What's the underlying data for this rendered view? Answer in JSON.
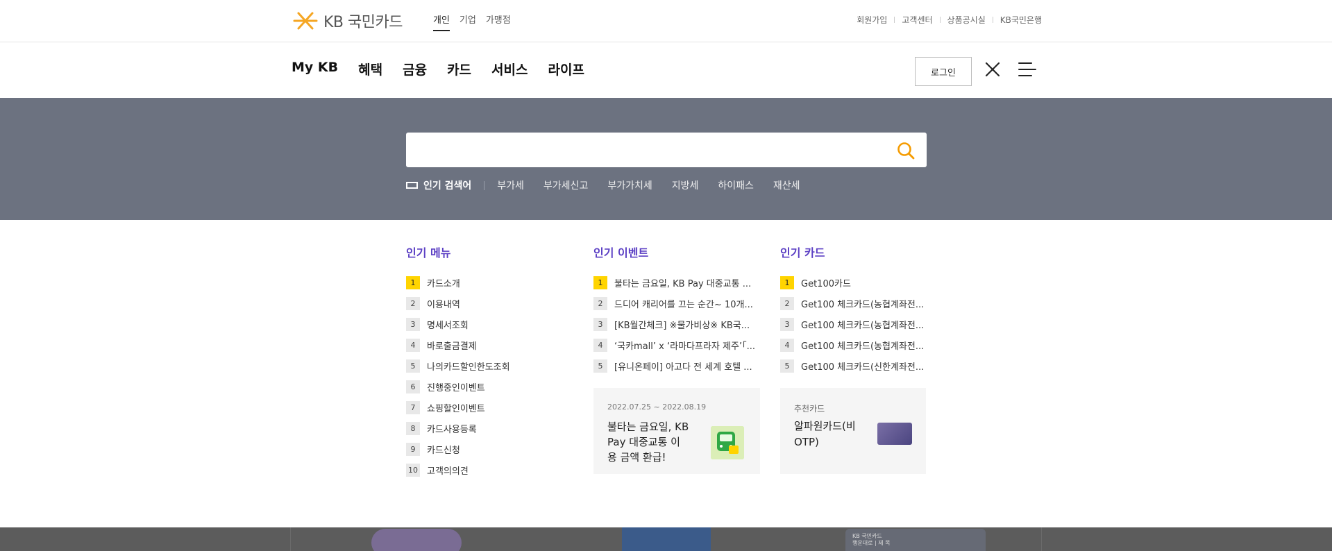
{
  "brand": {
    "logo_text": "KB 국민카드",
    "accent": "#f5a623"
  },
  "segment": [
    "개인",
    "기업",
    "가맹점"
  ],
  "utility_links": [
    "회원가입",
    "고객센터",
    "상품공시실",
    "KB국민은행"
  ],
  "gnb": {
    "items": [
      "My KB",
      "혜택",
      "금융",
      "카드",
      "서비스",
      "라이프"
    ],
    "login_label": "로그인"
  },
  "search": {
    "placeholder": "",
    "popular_title": "인기 검색어",
    "keywords": [
      "부가세",
      "부가세신고",
      "부가가치세",
      "지방세",
      "하이패스",
      "재산세"
    ]
  },
  "popular_menu": {
    "title": "인기 메뉴",
    "items": [
      {
        "rank": "1",
        "text": "카드소개"
      },
      {
        "rank": "2",
        "text": "이용내역"
      },
      {
        "rank": "3",
        "text": "명세서조회"
      },
      {
        "rank": "4",
        "text": "바로출금결제"
      },
      {
        "rank": "5",
        "text": "나의카드할인한도조회"
      },
      {
        "rank": "6",
        "text": "진행중인이벤트"
      },
      {
        "rank": "7",
        "text": "쇼핑할인이벤트"
      },
      {
        "rank": "8",
        "text": "카드사용등록"
      },
      {
        "rank": "9",
        "text": "카드신청"
      },
      {
        "rank": "10",
        "text": "고객의의견"
      }
    ]
  },
  "popular_events": {
    "title": "인기 이벤트",
    "items": [
      {
        "rank": "1",
        "text": "불타는 금요일, KB Pay 대중교통 ..."
      },
      {
        "rank": "2",
        "text": "드디어 캐리어를 끄는 순간~ 10개..."
      },
      {
        "rank": "3",
        "text": "[KB월간체크] ※물가비상※ KB국..."
      },
      {
        "rank": "4",
        "text": "‘국카mall’ x ‘라마다프라자 제주’「..."
      },
      {
        "rank": "5",
        "text": "[유니온페이] 아고다 전 세계 호텔 ..."
      }
    ],
    "promo": {
      "date": "2022.07.25 ~ 2022.08.19",
      "title": "불타는 금요일, KB Pay 대중교통 이용 금액 환급!"
    }
  },
  "popular_cards": {
    "title": "인기 카드",
    "items": [
      {
        "rank": "1",
        "text": "Get100카드"
      },
      {
        "rank": "2",
        "text": "Get100 체크카드(농협계좌전..."
      },
      {
        "rank": "3",
        "text": "Get100 체크카드(농협계좌전..."
      },
      {
        "rank": "4",
        "text": "Get100 체크카드(농협계좌전..."
      },
      {
        "rank": "5",
        "text": "Get100 체크카드(신한계좌전..."
      }
    ],
    "recommend": {
      "label": "추천카드",
      "name": "알파원카드(비OTP)"
    }
  },
  "background_preview": {
    "text_line1": "KB 국민카드",
    "text_line2": "행운대로 | 제 목"
  },
  "colors": {
    "band": "#6c7280",
    "title_purple": "#5b3fc4",
    "rank_yellow": "#ffd400"
  }
}
